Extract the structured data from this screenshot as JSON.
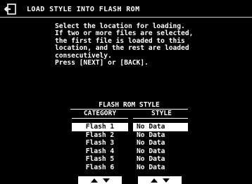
{
  "header": {
    "icon": "back-arrow-icon",
    "title": "LOAD STYLE INTO FLASH ROM"
  },
  "instructions": {
    "lines": [
      "Select the location for loading.",
      "If two or more files are selected,",
      "the first file is loaded to this",
      "location, and the rest are loaded",
      "consecutively.",
      "Press [NEXT] or [BACK]."
    ]
  },
  "table": {
    "title": "FLASH ROM STYLE",
    "category_header": "CATEGORY",
    "style_header": "STYLE",
    "categories": [
      "Flash 1",
      "Flash 2",
      "Flash 3",
      "Flash 4",
      "Flash 5",
      "Flash 6"
    ],
    "styles": [
      "No Data",
      "No Data",
      "No Data",
      "No Data",
      "No Data",
      "No Data"
    ],
    "selected_index": 0
  },
  "colors": {
    "background": "#000000",
    "foreground": "#ffffff"
  }
}
